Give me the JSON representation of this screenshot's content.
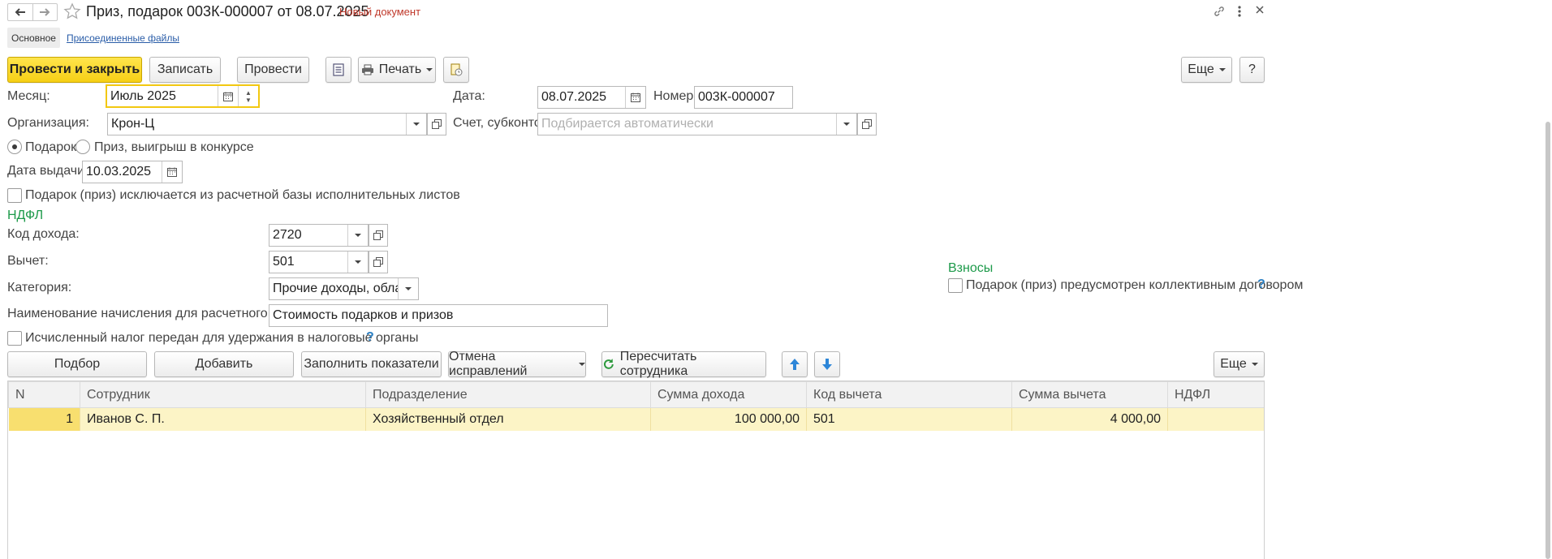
{
  "window": {
    "title": "Приз, подарок 003К-000007 от 08.07.2025",
    "status": "Новый документ"
  },
  "tabs": [
    {
      "label": "Основное"
    },
    {
      "label": "Присоединенные файлы"
    }
  ],
  "toolbar": {
    "post_close": "Провести и закрыть",
    "save": "Записать",
    "post": "Провести",
    "print": "Печать",
    "more": "Еще",
    "help": "?"
  },
  "form": {
    "month_label": "Месяц:",
    "month_value": "Июль 2025",
    "date_label": "Дата:",
    "date_value": "08.07.2025",
    "number_label": "Номер:",
    "number_value": "003К-000007",
    "org_label": "Организация:",
    "org_value": "Крон-Ц",
    "account_label": "Счет, субконто:",
    "account_placeholder": "Подбирается автоматически",
    "radio_gift": "Подарок",
    "radio_prize": "Приз, выигрыш в конкурсе",
    "issue_date_label": "Дата выдачи:",
    "issue_date_value": "10.03.2025",
    "exclude_label": "Подарок (приз) исключается из расчетной базы исполнительных листов",
    "ndfl_header": "НДФЛ",
    "income_code_label": "Код дохода:",
    "income_code_value": "2720",
    "deduction_label": "Вычет:",
    "deduction_value": "501",
    "category_label": "Категория:",
    "category_value": "Прочие доходы, облагаемые",
    "accrual_name_label": "Наименование начисления для расчетного листа:",
    "accrual_name_value": "Стоимость подарков и призов",
    "tax_transferred_label": "Исчисленный налог передан для удержания в налоговые органы",
    "help_mark": "?",
    "contrib_header": "Взносы",
    "contrib_check_label": "Подарок (приз) предусмотрен коллективным договором"
  },
  "table_toolbar": {
    "pick": "Подбор",
    "add": "Добавить",
    "fill": "Заполнить показатели",
    "cancel_fix": "Отмена исправлений",
    "recalc": "Пересчитать сотрудника",
    "more": "Еще"
  },
  "table": {
    "columns": [
      "N",
      "Сотрудник",
      "Подразделение",
      "Сумма дохода",
      "Код вычета",
      "Сумма вычета",
      "НДФЛ"
    ],
    "rows": [
      {
        "n": "1",
        "employee": "Иванов С. П.",
        "department": "Хозяйственный отдел",
        "income": "100 000,00",
        "deduction_code": "501",
        "deduction_sum": "4 000,00",
        "ndfl": ""
      }
    ]
  },
  "colors": {
    "primary_button": "#f6cf16",
    "section_header": "#1d9a4a",
    "selected_row": "#fcf4c6",
    "status_text": "#c0392b"
  }
}
